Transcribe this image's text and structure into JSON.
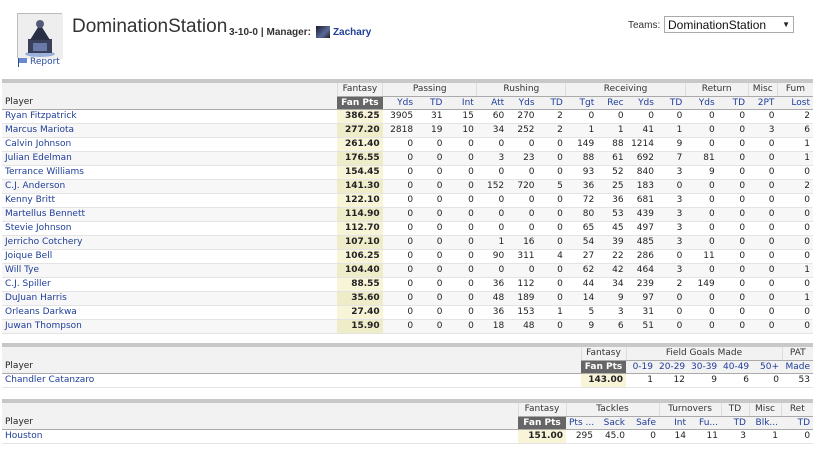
{
  "header": {
    "team_name": "DominationStation",
    "record": "3-10-0",
    "manager_label": "| Manager:",
    "manager_name": "Zachary",
    "report_label": "Report",
    "teams_label": "Teams:",
    "teams_selected": "DominationStation"
  },
  "offense": {
    "groups": [
      "Fantasy",
      "Passing",
      "Rushing",
      "Receiving",
      "Return",
      "Misc",
      "Fum"
    ],
    "columns": [
      "Player",
      "Fan Pts",
      "Yds",
      "TD",
      "Int",
      "Att",
      "Yds",
      "TD",
      "Tgt",
      "Rec",
      "Yds",
      "TD",
      "Yds",
      "TD",
      "2PT",
      "Lost"
    ],
    "rows": [
      [
        "Ryan Fitzpatrick",
        "386.25",
        "3905",
        "31",
        "15",
        "60",
        "270",
        "2",
        "0",
        "0",
        "0",
        "0",
        "0",
        "0",
        "0",
        "2"
      ],
      [
        "Marcus Mariota",
        "277.20",
        "2818",
        "19",
        "10",
        "34",
        "252",
        "2",
        "1",
        "1",
        "41",
        "1",
        "0",
        "0",
        "3",
        "6"
      ],
      [
        "Calvin Johnson",
        "261.40",
        "0",
        "0",
        "0",
        "0",
        "0",
        "0",
        "149",
        "88",
        "1214",
        "9",
        "0",
        "0",
        "0",
        "1"
      ],
      [
        "Julian Edelman",
        "176.55",
        "0",
        "0",
        "0",
        "3",
        "23",
        "0",
        "88",
        "61",
        "692",
        "7",
        "81",
        "0",
        "0",
        "1"
      ],
      [
        "Terrance Williams",
        "154.45",
        "0",
        "0",
        "0",
        "0",
        "0",
        "0",
        "93",
        "52",
        "840",
        "3",
        "9",
        "0",
        "0",
        "0"
      ],
      [
        "C.J. Anderson",
        "141.30",
        "0",
        "0",
        "0",
        "152",
        "720",
        "5",
        "36",
        "25",
        "183",
        "0",
        "0",
        "0",
        "0",
        "2"
      ],
      [
        "Kenny Britt",
        "122.10",
        "0",
        "0",
        "0",
        "0",
        "0",
        "0",
        "72",
        "36",
        "681",
        "3",
        "0",
        "0",
        "0",
        "0"
      ],
      [
        "Martellus Bennett",
        "114.90",
        "0",
        "0",
        "0",
        "0",
        "0",
        "0",
        "80",
        "53",
        "439",
        "3",
        "0",
        "0",
        "0",
        "0"
      ],
      [
        "Stevie Johnson",
        "112.70",
        "0",
        "0",
        "0",
        "0",
        "0",
        "0",
        "65",
        "45",
        "497",
        "3",
        "0",
        "0",
        "0",
        "0"
      ],
      [
        "Jerricho Cotchery",
        "107.10",
        "0",
        "0",
        "0",
        "1",
        "16",
        "0",
        "54",
        "39",
        "485",
        "3",
        "0",
        "0",
        "0",
        "0"
      ],
      [
        "Joique Bell",
        "106.25",
        "0",
        "0",
        "0",
        "90",
        "311",
        "4",
        "27",
        "22",
        "286",
        "0",
        "11",
        "0",
        "0",
        "0"
      ],
      [
        "Will Tye",
        "104.40",
        "0",
        "0",
        "0",
        "0",
        "0",
        "0",
        "62",
        "42",
        "464",
        "3",
        "0",
        "0",
        "0",
        "1"
      ],
      [
        "C.J. Spiller",
        "88.55",
        "0",
        "0",
        "0",
        "36",
        "112",
        "0",
        "44",
        "34",
        "239",
        "2",
        "149",
        "0",
        "0",
        "0"
      ],
      [
        "DuJuan Harris",
        "35.60",
        "0",
        "0",
        "0",
        "48",
        "189",
        "0",
        "14",
        "9",
        "97",
        "0",
        "0",
        "0",
        "0",
        "1"
      ],
      [
        "Orleans Darkwa",
        "27.40",
        "0",
        "0",
        "0",
        "36",
        "153",
        "1",
        "5",
        "3",
        "31",
        "0",
        "0",
        "0",
        "0",
        "0"
      ],
      [
        "Juwan Thompson",
        "15.90",
        "0",
        "0",
        "0",
        "18",
        "48",
        "0",
        "9",
        "6",
        "51",
        "0",
        "0",
        "0",
        "0",
        "0"
      ]
    ]
  },
  "kicker": {
    "groups": [
      "Fantasy",
      "Field Goals Made",
      "PAT"
    ],
    "columns": [
      "Player",
      "Fan Pts",
      "0-19",
      "20-29",
      "30-39",
      "40-49",
      "50+",
      "Made"
    ],
    "rows": [
      [
        "Chandler Catanzaro",
        "143.00",
        "1",
        "12",
        "9",
        "6",
        "0",
        "53"
      ]
    ]
  },
  "defense": {
    "groups": [
      "Fantasy",
      "Tackles",
      "Turnovers",
      "TD",
      "Misc",
      "Ret"
    ],
    "columns": [
      "Player",
      "Fan Pts",
      "Pts ...",
      "Sack",
      "Safe",
      "Int",
      "Fu...",
      "TD",
      "Blk...",
      "TD"
    ],
    "rows": [
      [
        "Houston",
        "151.00",
        "295",
        "45.0",
        "0",
        "14",
        "11",
        "3",
        "1",
        "0"
      ]
    ]
  }
}
